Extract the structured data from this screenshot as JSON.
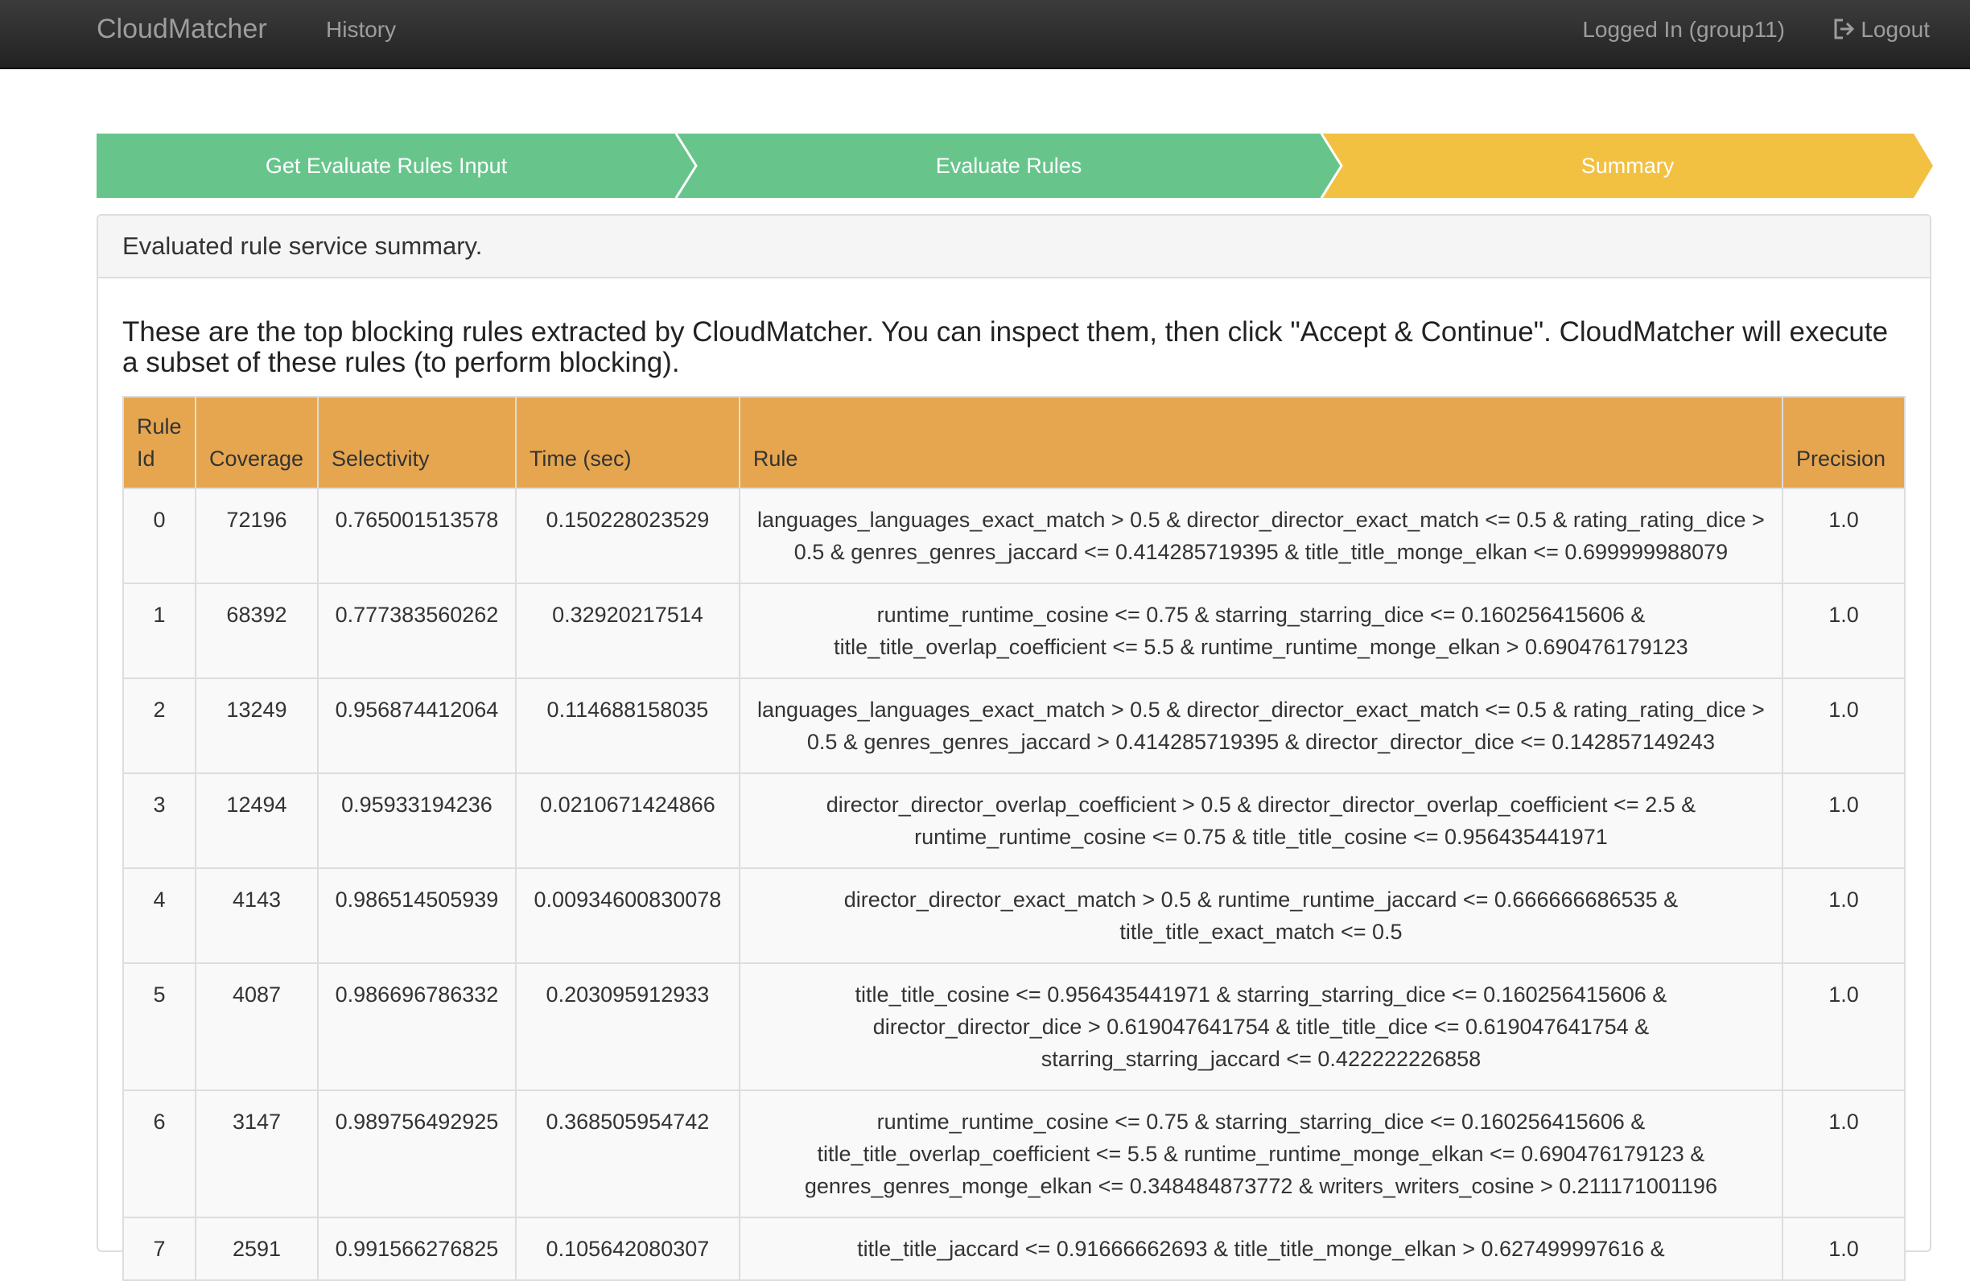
{
  "navbar": {
    "brand": "CloudMatcher",
    "history": "History",
    "user": "Logged In (group11)",
    "logout": "Logout"
  },
  "steps": [
    {
      "label": "Get Evaluate Rules Input",
      "color": "#67c58c"
    },
    {
      "label": "Evaluate Rules",
      "color": "#67c58c"
    },
    {
      "label": "Summary",
      "color": "#f2c142"
    }
  ],
  "panel": {
    "heading": "Evaluated rule service summary.",
    "intro": "These are the top blocking rules extracted by CloudMatcher. You can inspect them, then click \"Accept & Continue\". CloudMatcher will execute a subset of these rules (to perform blocking)."
  },
  "table": {
    "headers": [
      "Rule Id",
      "Coverage",
      "Selectivity",
      "Time (sec)",
      "Rule",
      "Precision"
    ],
    "rows": [
      {
        "id": "0",
        "coverage": "72196",
        "selectivity": "0.765001513578",
        "time": "0.150228023529",
        "rule": "languages_languages_exact_match > 0.5 & director_director_exact_match <= 0.5 & rating_rating_dice > 0.5 & genres_genres_jaccard <= 0.414285719395 & title_title_monge_elkan <= 0.699999988079",
        "precision": "1.0"
      },
      {
        "id": "1",
        "coverage": "68392",
        "selectivity": "0.777383560262",
        "time": "0.32920217514",
        "rule": "runtime_runtime_cosine <= 0.75 & starring_starring_dice <= 0.160256415606 & title_title_overlap_coefficient <= 5.5 & runtime_runtime_monge_elkan > 0.690476179123",
        "precision": "1.0"
      },
      {
        "id": "2",
        "coverage": "13249",
        "selectivity": "0.956874412064",
        "time": "0.114688158035",
        "rule": "languages_languages_exact_match > 0.5 & director_director_exact_match <= 0.5 & rating_rating_dice > 0.5 & genres_genres_jaccard > 0.414285719395 & director_director_dice <= 0.142857149243",
        "precision": "1.0"
      },
      {
        "id": "3",
        "coverage": "12494",
        "selectivity": "0.95933194236",
        "time": "0.0210671424866",
        "rule": "director_director_overlap_coefficient > 0.5 & director_director_overlap_coefficient <= 2.5 & runtime_runtime_cosine <= 0.75 & title_title_cosine <= 0.956435441971",
        "precision": "1.0"
      },
      {
        "id": "4",
        "coverage": "4143",
        "selectivity": "0.986514505939",
        "time": "0.00934600830078",
        "rule": "director_director_exact_match > 0.5 & runtime_runtime_jaccard <= 0.666666686535 & title_title_exact_match <= 0.5",
        "precision": "1.0"
      },
      {
        "id": "5",
        "coverage": "4087",
        "selectivity": "0.986696786332",
        "time": "0.203095912933",
        "rule": "title_title_cosine <= 0.956435441971 & starring_starring_dice <= 0.160256415606 & director_director_dice > 0.619047641754 & title_title_dice <= 0.619047641754 & starring_starring_jaccard <= 0.422222226858",
        "precision": "1.0"
      },
      {
        "id": "6",
        "coverage": "3147",
        "selectivity": "0.989756492925",
        "time": "0.368505954742",
        "rule": "runtime_runtime_cosine <= 0.75 & starring_starring_dice <= 0.160256415606 & title_title_overlap_coefficient <= 5.5 & runtime_runtime_monge_elkan <= 0.690476179123 & genres_genres_monge_elkan <= 0.348484873772 & writers_writers_cosine > 0.211171001196",
        "precision": "1.0"
      },
      {
        "id": "7",
        "coverage": "2591",
        "selectivity": "0.991566276825",
        "time": "0.105642080307",
        "rule": "title_title_jaccard <= 0.91666662693 & title_title_monge_elkan > 0.627499997616 &",
        "precision": "1.0"
      }
    ]
  }
}
